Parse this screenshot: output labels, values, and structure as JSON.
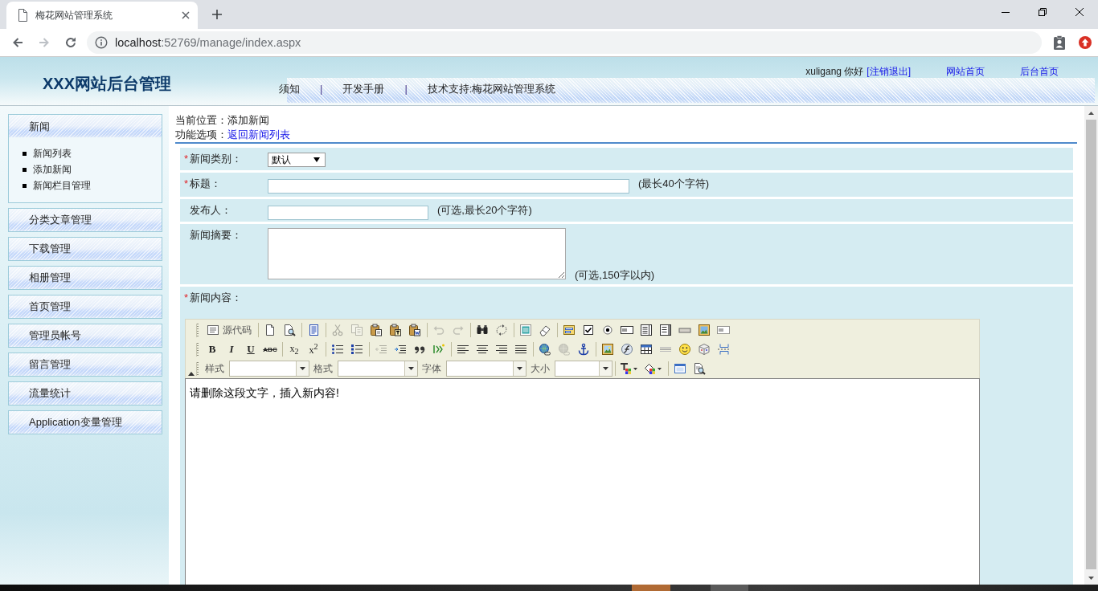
{
  "browser": {
    "tabs": [
      {
        "title": "梅花网站管理系统",
        "selected": true
      }
    ],
    "nav_buttons": [
      {
        "kind": "back",
        "disabled": false
      },
      {
        "kind": "forward",
        "disabled": true
      },
      {
        "kind": "reload",
        "disabled": false
      }
    ],
    "address": {
      "host": "localhost",
      "path": ":52769/manage/index.aspx"
    }
  },
  "header": {
    "title": "XXX网站后台管理",
    "user": {
      "greeting": "xuligang 你好",
      "logout": "[注销退出]"
    },
    "links": [
      "网站首页",
      "后台首页"
    ],
    "nav": [
      {
        "kind": "link",
        "label": "须知"
      },
      {
        "kind": "divider",
        "label": "|"
      },
      {
        "kind": "link",
        "label": "开发手册"
      },
      {
        "kind": "divider",
        "label": "|"
      },
      {
        "kind": "link",
        "label": "技术支持:梅花网站管理系统"
      }
    ]
  },
  "sidebar": {
    "items": [
      {
        "label": "新闻",
        "expanded": true,
        "children": [
          {
            "label": "新闻列表"
          },
          {
            "label": "添加新闻"
          },
          {
            "label": "新闻栏目管理"
          }
        ]
      },
      {
        "label": "分类文章管理",
        "expanded": false
      },
      {
        "label": "下载管理",
        "expanded": false
      },
      {
        "label": "相册管理",
        "expanded": false
      },
      {
        "label": "首页管理",
        "expanded": false
      },
      {
        "label": "管理员帐号",
        "expanded": false
      },
      {
        "label": "留言管理",
        "expanded": false
      },
      {
        "label": "流量统计",
        "expanded": false
      },
      {
        "label": "Application变量管理",
        "expanded": false
      }
    ]
  },
  "breadcrumb": {
    "label": "当前位置：",
    "value": "添加新闻"
  },
  "options": {
    "label": "功能选项：",
    "link": "返回新闻列表"
  },
  "form": {
    "rows": [
      {
        "kind": "select",
        "required_mark": "*",
        "label": "新闻类别：",
        "value": "默认"
      },
      {
        "kind": "longtext",
        "required_mark": "*",
        "label": "标题：",
        "hint": "(最长40个字符)"
      },
      {
        "kind": "shorttext",
        "label": "发布人：",
        "hint": "(可选,最长20个字符)"
      },
      {
        "kind": "textarea",
        "label": "新闻摘要：",
        "hint": "(可选,150字以内)"
      },
      {
        "kind": "editor",
        "required_mark": "*",
        "label": "新闻内容："
      }
    ]
  },
  "editor": {
    "toolbar": [
      [
        [
          {
            "kind": "source",
            "label": "源代码",
            "disabled": false
          }
        ],
        [
          {
            "kind": "newpage",
            "disabled": false
          },
          {
            "kind": "preview",
            "disabled": false
          }
        ],
        [
          {
            "kind": "templates",
            "disabled": false
          }
        ],
        [
          {
            "kind": "cut",
            "disabled": true
          },
          {
            "kind": "copy",
            "disabled": true
          },
          {
            "kind": "paste",
            "disabled": false
          },
          {
            "kind": "pastetext",
            "disabled": false
          },
          {
            "kind": "pasteword",
            "disabled": false
          }
        ],
        [
          {
            "kind": "undo",
            "disabled": true
          },
          {
            "kind": "redo",
            "disabled": true
          }
        ],
        [
          {
            "kind": "find",
            "disabled": false
          },
          {
            "kind": "replace",
            "disabled": false
          }
        ],
        [
          {
            "kind": "selectall",
            "disabled": false
          },
          {
            "kind": "removeformat",
            "disabled": false
          }
        ],
        [
          {
            "kind": "form",
            "disabled": false
          },
          {
            "kind": "checkbox",
            "disabled": false
          },
          {
            "kind": "radio",
            "disabled": false
          },
          {
            "kind": "textfield",
            "disabled": false
          },
          {
            "kind": "textarea",
            "disabled": false
          },
          {
            "kind": "select",
            "disabled": false
          },
          {
            "kind": "button",
            "disabled": false
          },
          {
            "kind": "imagebutton",
            "disabled": false
          },
          {
            "kind": "hiddenfield",
            "disabled": false
          }
        ]
      ],
      [
        [
          {
            "kind": "bold",
            "label": "B",
            "disabled": false
          },
          {
            "kind": "italic",
            "label": "I",
            "disabled": false
          },
          {
            "kind": "underline",
            "label": "U",
            "disabled": false
          },
          {
            "kind": "strike",
            "label": "ABC",
            "disabled": false
          }
        ],
        [
          {
            "kind": "subscript",
            "label": "x$_{2}$",
            "disabled": false
          },
          {
            "kind": "superscript",
            "label": "x$^{2}$",
            "disabled": false
          }
        ],
        [
          {
            "kind": "orderedlist",
            "disabled": false
          },
          {
            "kind": "unorderedlist",
            "disabled": false
          }
        ],
        [
          {
            "kind": "outdent",
            "disabled": true
          },
          {
            "kind": "indent",
            "disabled": false
          },
          {
            "kind": "blockquote",
            "disabled": false
          },
          {
            "kind": "creatediv",
            "disabled": false
          }
        ],
        [
          {
            "kind": "alignleft",
            "disabled": false
          },
          {
            "kind": "aligncenter",
            "disabled": false
          },
          {
            "kind": "alignright",
            "disabled": false
          },
          {
            "kind": "alignjustify",
            "disabled": false
          }
        ],
        [
          {
            "kind": "link",
            "disabled": false
          },
          {
            "kind": "unlink",
            "disabled": true
          },
          {
            "kind": "anchor",
            "disabled": false
          }
        ],
        [
          {
            "kind": "image",
            "disabled": false
          },
          {
            "kind": "flash",
            "disabled": false
          },
          {
            "kind": "table",
            "disabled": false
          },
          {
            "kind": "rule",
            "disabled": false
          },
          {
            "kind": "smiley",
            "disabled": false
          },
          {
            "kind": "specialchar",
            "disabled": false
          },
          {
            "kind": "pagebreak",
            "disabled": false
          }
        ]
      ],
      [
        [
          {
            "kind": "combo",
            "label": "样式",
            "disabled": false
          },
          {
            "kind": "combo",
            "label": "格式",
            "disabled": false
          },
          {
            "kind": "combo",
            "label": "字体",
            "disabled": false
          },
          {
            "kind": "sizecombo",
            "label": "大小",
            "disabled": false
          }
        ],
        [
          {
            "kind": "textcolor",
            "disabled": false
          },
          {
            "kind": "bgcolor",
            "disabled": false
          }
        ],
        [
          {
            "kind": "maximize",
            "disabled": false
          },
          {
            "kind": "showblocks",
            "disabled": false
          }
        ]
      ]
    ],
    "content": "请删除这段文字，插入新内容!"
  }
}
